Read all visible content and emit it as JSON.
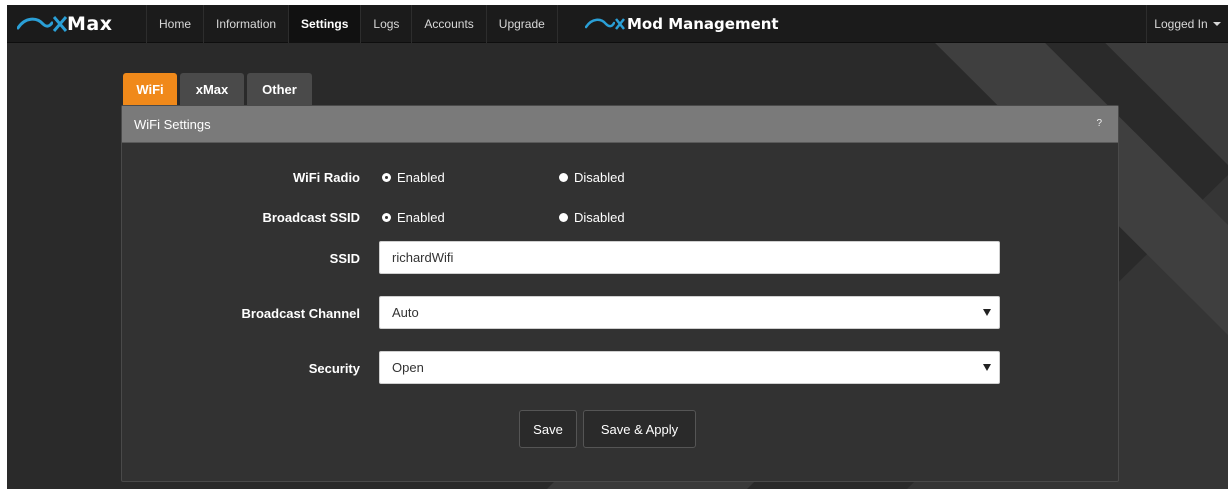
{
  "navbar": {
    "brand": "Max",
    "items": [
      {
        "label": "Home",
        "active": false
      },
      {
        "label": "Information",
        "active": false
      },
      {
        "label": "Settings",
        "active": true
      },
      {
        "label": "Logs",
        "active": false
      },
      {
        "label": "Accounts",
        "active": false
      },
      {
        "label": "Upgrade",
        "active": false
      }
    ],
    "mod_brand": "Mod Management",
    "user_menu": "Logged In"
  },
  "tabs": [
    {
      "label": "WiFi",
      "active": true
    },
    {
      "label": "xMax",
      "active": false
    },
    {
      "label": "Other",
      "active": false
    }
  ],
  "panel": {
    "title": "WiFi Settings",
    "help": "?",
    "wifi_radio": {
      "label": "WiFi Radio",
      "options": [
        "Enabled",
        "Disabled"
      ],
      "selected": "Enabled"
    },
    "broadcast_ssid": {
      "label": "Broadcast SSID",
      "options": [
        "Enabled",
        "Disabled"
      ],
      "selected": "Enabled"
    },
    "ssid": {
      "label": "SSID",
      "value": "richardWifi"
    },
    "broadcast_channel": {
      "label": "Broadcast Channel",
      "value": "Auto"
    },
    "security": {
      "label": "Security",
      "value": "Open"
    },
    "save_label": "Save",
    "save_apply_label": "Save & Apply"
  },
  "colors": {
    "accent": "#f0891a",
    "brand_blue": "#2a9fd6",
    "background": "#2a2a2a",
    "navbar": "#1b1b1b"
  }
}
